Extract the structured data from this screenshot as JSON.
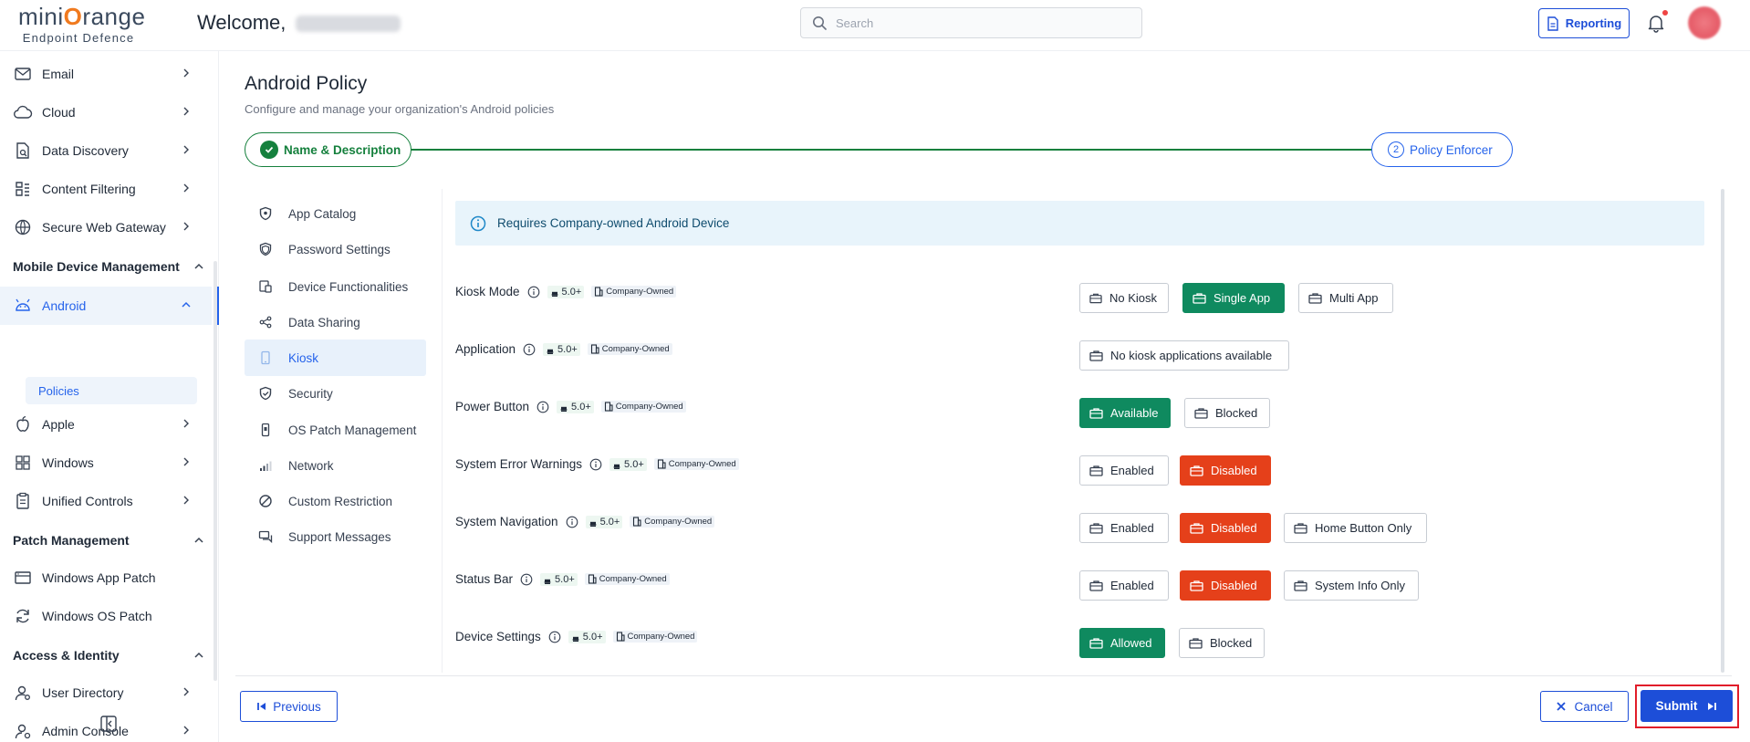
{
  "header": {
    "logo_main_pre": "mini",
    "logo_main_o": "O",
    "logo_main_post": "range",
    "logo_sub": "Endpoint Defence",
    "welcome": "Welcome,",
    "search_placeholder": "Search",
    "reporting_label": "Reporting"
  },
  "sidebar": {
    "items": [
      {
        "label": "Email",
        "icon": "mail-icon"
      },
      {
        "label": "Cloud",
        "icon": "cloud-icon"
      },
      {
        "label": "Data Discovery",
        "icon": "data-discovery-icon"
      },
      {
        "label": "Content Filtering",
        "icon": "content-filtering-icon"
      },
      {
        "label": "Secure Web Gateway",
        "icon": "globe-icon"
      }
    ],
    "section_mdm": "Mobile Device Management",
    "android": "Android",
    "policies": "Policies",
    "apple": "Apple",
    "windows": "Windows",
    "unified": "Unified Controls",
    "section_patch": "Patch Management",
    "win_app_patch": "Windows App Patch",
    "win_os_patch": "Windows OS Patch",
    "section_access": "Access & Identity",
    "user_directory": "User Directory",
    "admin_console": "Admin Console"
  },
  "main": {
    "title": "Android Policy",
    "subtitle": "Configure and manage your organization's Android policies",
    "step1": "Name & Description",
    "step2_num": "2",
    "step2": "Policy Enforcer"
  },
  "subnav": [
    {
      "label": "App Catalog",
      "icon": "shield-check-icon"
    },
    {
      "label": "Password Settings",
      "icon": "password-icon"
    },
    {
      "label": "Device Functionalities",
      "icon": "devices-icon"
    },
    {
      "label": "Data Sharing",
      "icon": "share-icon"
    },
    {
      "label": "Kiosk",
      "icon": "phone-icon"
    },
    {
      "label": "Security",
      "icon": "shield-icon"
    },
    {
      "label": "OS Patch Management",
      "icon": "phone-patch-icon"
    },
    {
      "label": "Network",
      "icon": "signal-icon"
    },
    {
      "label": "Custom Restriction",
      "icon": "restriction-icon"
    },
    {
      "label": "Support Messages",
      "icon": "messages-icon"
    }
  ],
  "banner": "Requires Company-owned Android Device",
  "version": "5.0+",
  "owned": "Company-Owned",
  "rows": [
    {
      "label": "Kiosk Mode",
      "options": [
        {
          "label": "No Kiosk",
          "state": "default"
        },
        {
          "label": "Single App",
          "state": "selected"
        },
        {
          "label": "Multi App",
          "state": "default"
        }
      ]
    },
    {
      "label": "Application",
      "options": [
        {
          "label": "No kiosk applications available",
          "state": "default"
        }
      ]
    },
    {
      "label": "Power Button",
      "options": [
        {
          "label": "Available",
          "state": "selected"
        },
        {
          "label": "Blocked",
          "state": "default"
        }
      ]
    },
    {
      "label": "System Error Warnings",
      "options": [
        {
          "label": "Enabled",
          "state": "default"
        },
        {
          "label": "Disabled",
          "state": "danger"
        }
      ]
    },
    {
      "label": "System Navigation",
      "options": [
        {
          "label": "Enabled",
          "state": "default"
        },
        {
          "label": "Disabled",
          "state": "danger"
        },
        {
          "label": "Home Button Only",
          "state": "default"
        }
      ]
    },
    {
      "label": "Status Bar",
      "options": [
        {
          "label": "Enabled",
          "state": "default"
        },
        {
          "label": "Disabled",
          "state": "danger"
        },
        {
          "label": "System Info Only",
          "state": "default"
        }
      ]
    },
    {
      "label": "Device Settings",
      "options": [
        {
          "label": "Allowed",
          "state": "selected"
        },
        {
          "label": "Blocked",
          "state": "default"
        }
      ]
    }
  ],
  "footer": {
    "previous": "Previous",
    "cancel": "Cancel",
    "submit": "Submit"
  },
  "colors": {
    "primary": "#1d4ed8",
    "success": "#0f8a5f",
    "danger": "#e5401a",
    "highlight": "#e11d2a"
  }
}
